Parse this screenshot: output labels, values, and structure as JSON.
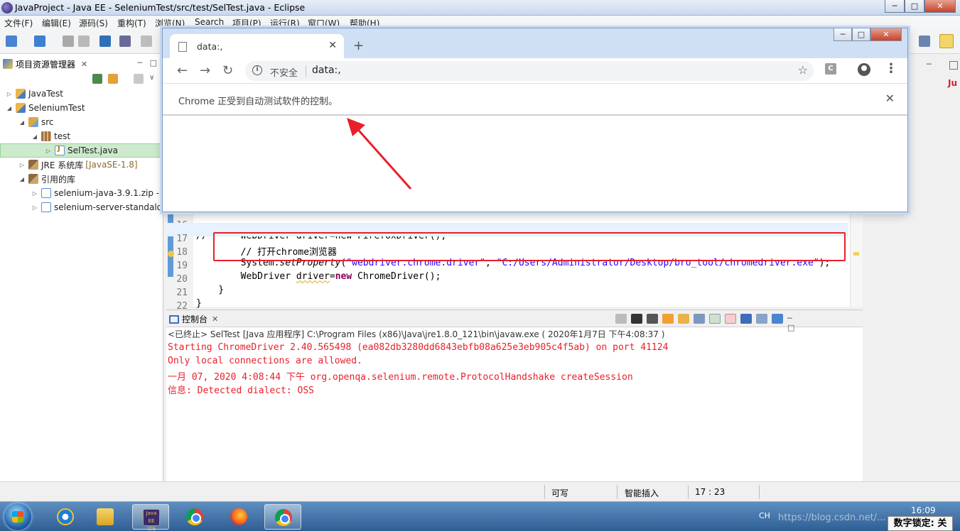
{
  "eclipse": {
    "title": "JavaProject - Java EE - SeleniumTest/src/test/SelTest.java - Eclipse",
    "menu": [
      "文件(F)",
      "编辑(E)",
      "源码(S)",
      "重构(T)",
      "浏览(N)",
      "Search",
      "项目(P)",
      "运行(R)",
      "窗口(W)",
      "帮助(H)"
    ],
    "window_buttons": {
      "minimize": "─",
      "maximize": "□",
      "close": "✕"
    }
  },
  "explorer": {
    "title": "项目资源管理器",
    "close": "✕",
    "tree": [
      {
        "label": "JavaTest",
        "deco": "",
        "arrow": "▷",
        "icon": "project-icon"
      },
      {
        "label": "SeleniumTest",
        "deco": "",
        "arrow": "◢",
        "icon": "project-icon"
      },
      {
        "label": "src",
        "deco": "",
        "arrow": "◢",
        "icon": "source-folder-icon"
      },
      {
        "label": "test",
        "deco": "",
        "arrow": "◢",
        "icon": "package-icon"
      },
      {
        "label": "SelTest.java",
        "deco": "",
        "arrow": "▷",
        "icon": "java-file-icon",
        "selected": true
      },
      {
        "label": "JRE 系统库",
        "deco": "[JavaSE-1.8]",
        "arrow": "▷",
        "icon": "library-icon"
      },
      {
        "label": "引用的库",
        "deco": "",
        "arrow": "◢",
        "icon": "library-icon"
      },
      {
        "label": "selenium-java-3.9.1.zip -",
        "deco": "",
        "arrow": "▷",
        "icon": "jar-icon"
      },
      {
        "label": "selenium-server-standalo",
        "deco": "",
        "arrow": "▷",
        "icon": "jar-icon"
      }
    ]
  },
  "editor": {
    "lines": [
      {
        "n": "16",
        "code": "//      WebDriver driver=new FirefoxDriver();"
      },
      {
        "n": "17",
        "code": "        // 打开chrome浏览器"
      },
      {
        "n": "18",
        "pre": "        System.",
        "method": "setProperty",
        "open": "(",
        "arg1": "\"webdriver.chrome.driver\"",
        "sep": ", ",
        "arg2": "\"C:/Users/Administrator/Desktop/bro_tool/chromedriver.exe\"",
        "close": ");"
      },
      {
        "n": "19",
        "pre": "        WebDriver ",
        "var": "driver",
        "eq": "=",
        "kw": "new",
        "rest": " ChromeDriver();"
      },
      {
        "n": "20",
        "code": "    }"
      },
      {
        "n": "21",
        "code": "}"
      },
      {
        "n": "22",
        "code": ""
      }
    ]
  },
  "console": {
    "title": "控制台",
    "close": "✕",
    "terminated": "<已终止> SelTest [Java 应用程序] C:\\Program Files (x86)\\Java\\jre1.8.0_121\\bin\\javaw.exe ( 2020年1月7日 下午4:08:37 )",
    "output": [
      "Starting ChromeDriver 2.40.565498 (ea082db3280dd6843ebfb08a625e3eb905c4f5ab) on port 41124",
      "Only local connections are allowed.",
      "一月 07, 2020 4:08:44 下午 org.openqa.selenium.remote.ProtocolHandshake createSession",
      "信息: Detected dialect: OSS"
    ]
  },
  "statusbar": {
    "writable": "可写",
    "insert": "智能插入",
    "position": "17 : 23"
  },
  "chrome": {
    "tab_title": "data:,",
    "tab_close": "✕",
    "new_tab": "+",
    "security": "不安全",
    "url": "data:,",
    "extension_letter": "C",
    "infobar": "Chrome 正受到自动测试软件的控制。",
    "infobar_close": "✕",
    "window_buttons": {
      "minimize": "─",
      "maximize": "□",
      "close": "✕"
    }
  },
  "taskbar": {
    "eclipse_label": "Java EE IDE",
    "tray": "CH",
    "clock": "16:09",
    "watermark": "https://blog.csdn.net/...",
    "numlock": "数字锁定: 关"
  },
  "colors": {
    "annotation_red": "#e8202a",
    "selection_green": "#cdeacd",
    "console_red": "#e8202a"
  }
}
